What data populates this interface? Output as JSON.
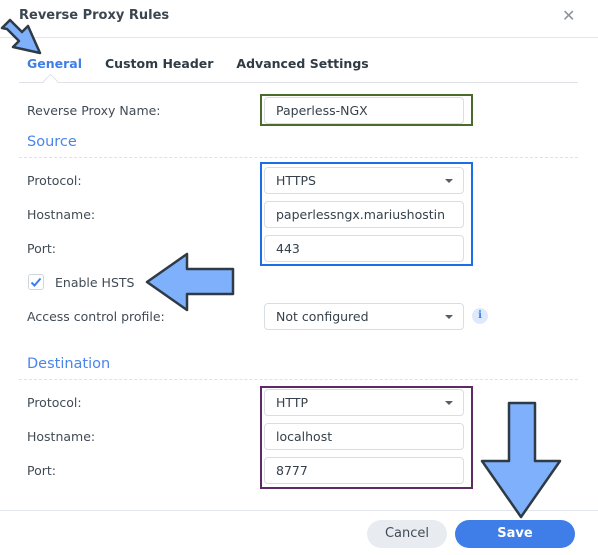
{
  "dialog": {
    "title": "Reverse Proxy Rules",
    "close_icon": "close-icon"
  },
  "tabs": [
    {
      "label": "General",
      "active": true
    },
    {
      "label": "Custom Header",
      "active": false
    },
    {
      "label": "Advanced Settings",
      "active": false
    }
  ],
  "general": {
    "name_label": "Reverse Proxy Name:",
    "name_value": "Paperless-NGX"
  },
  "source": {
    "heading": "Source",
    "protocol_label": "Protocol:",
    "protocol_value": "HTTPS",
    "hostname_label": "Hostname:",
    "hostname_value": "paperlessngx.mariushostin",
    "port_label": "Port:",
    "port_value": "443",
    "hsts_label": "Enable HSTS",
    "hsts_checked": true,
    "acl_label": "Access control profile:",
    "acl_value": "Not configured",
    "info_glyph": "i"
  },
  "destination": {
    "heading": "Destination",
    "protocol_label": "Protocol:",
    "protocol_value": "HTTP",
    "hostname_label": "Hostname:",
    "hostname_value": "localhost",
    "port_label": "Port:",
    "port_value": "8777"
  },
  "footer": {
    "cancel_label": "Cancel",
    "save_label": "Save"
  },
  "colors": {
    "accent": "#3f7ee8",
    "annotation_arrow": "#7fb0fb",
    "highlight_green": "#4a6b2b",
    "highlight_blue": "#1a6fe8",
    "highlight_purple": "#5e2a66"
  }
}
